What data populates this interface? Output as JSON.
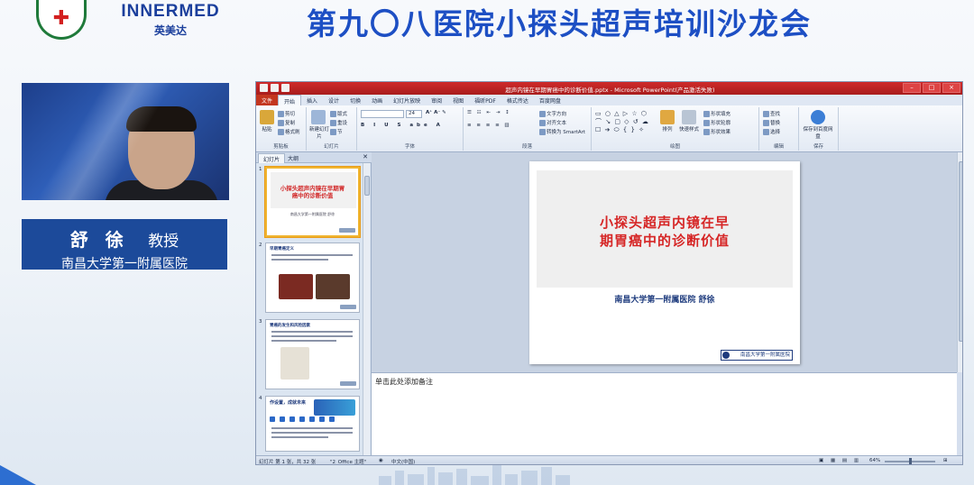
{
  "banner": {
    "brand_en": "INNERMED",
    "brand_cn": "英美达",
    "title": "第九〇八医院小探头超声培训沙龙会",
    "colors": {
      "title": "#1d4fc4",
      "brand": "#1b3f9c",
      "seal": "#1f7a3a"
    }
  },
  "speaker": {
    "name": "舒 徐",
    "role": "教授",
    "affiliation": "南昌大学第一附属医院",
    "card_color": "#1c4a9a"
  },
  "ppt": {
    "window_title": "超声内镜在早期胃癌中的诊断价值.pptx - Microsoft PowerPoint(产品激活失败)",
    "tabs": [
      "文件",
      "开始",
      "插入",
      "设计",
      "切换",
      "动画",
      "幻灯片放映",
      "审阅",
      "视图",
      "福昕PDF",
      "格式传达",
      "百度网盘"
    ],
    "active_tab": "开始",
    "ribbon": {
      "clipboard": {
        "label": "剪贴板",
        "paste": "粘贴",
        "cut": "剪切",
        "copy": "复制",
        "format_painter": "格式刷"
      },
      "slides": {
        "label": "幻灯片",
        "new_slide": "新建幻灯片",
        "layout": "版式",
        "reset": "重设",
        "section": "节"
      },
      "font": {
        "label": "字体",
        "size": "24"
      },
      "paragraph": {
        "label": "段落",
        "text_direction": "文字方向",
        "align_text": "对齐文本",
        "smartart": "转换为 SmartArt"
      },
      "drawing": {
        "label": "绘图",
        "arrange": "排列",
        "quick_styles": "快速样式",
        "shape_fill": "形状填充",
        "shape_outline": "形状轮廓",
        "shape_effects": "形状效果"
      },
      "editing": {
        "label": "编辑",
        "find": "查找",
        "replace": "替换",
        "select": "选择"
      },
      "save": {
        "label": "保存",
        "save_to_cloud": "保存到百度网盘"
      }
    },
    "panel_tabs": [
      "幻灯片",
      "大纲"
    ],
    "thumbnails": [
      {
        "num": "1",
        "title": "小探头超声内镜在早期胃癌中的诊断价值",
        "sub": "南昌大学第一附属医院 舒徐"
      },
      {
        "num": "2",
        "heading": "早期胃癌定义"
      },
      {
        "num": "3",
        "heading": "胃癌的发生和风险因素"
      },
      {
        "num": "4",
        "heading": "作设置，成就未来"
      }
    ],
    "slide": {
      "title_line1": "小探头超声内镜在早",
      "title_line2": "期胃癌中的诊断价值",
      "subtitle": "南昌大学第一附属医院   舒徐",
      "logo_text": "南昌大学第一附属医院",
      "title_color": "#d62626",
      "subtitle_color": "#1f3c7e"
    },
    "notes_placeholder": "单击此处添加备注",
    "status": {
      "slide_pos": "幻灯片 第 1 张，共 32 张",
      "theme": "\"2_Office 主题\"",
      "language": "中文(中国)",
      "zoom": "64%"
    }
  }
}
